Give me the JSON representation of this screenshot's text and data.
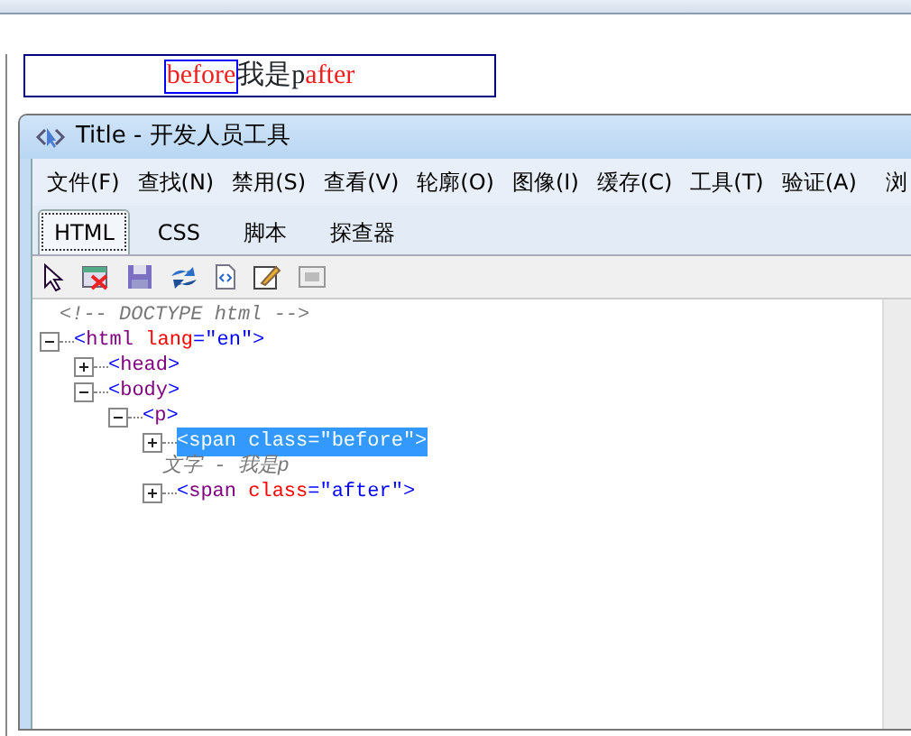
{
  "page": {
    "demo": {
      "before": "before",
      "middle": "我是p",
      "after": "after"
    }
  },
  "devtools": {
    "title": "Title - 开发人员工具",
    "menu": [
      "文件(F)",
      "查找(N)",
      "禁用(S)",
      "查看(V)",
      "轮廓(O)",
      "图像(I)",
      "缓存(C)",
      "工具(T)",
      "验证(A)",
      "浏"
    ],
    "tabs": [
      {
        "label": "HTML",
        "selected": true
      },
      {
        "label": "CSS",
        "selected": false
      },
      {
        "label": "脚本",
        "selected": false
      },
      {
        "label": "探查器",
        "selected": false
      }
    ],
    "tree": [
      {
        "kind": "comment",
        "text": "<!-- DOCTYPE html -->"
      },
      {
        "kind": "element",
        "parts": [
          {
            "kind": "bracket",
            "text": "<"
          },
          {
            "kind": "tag",
            "text": "html"
          },
          {
            "kind": "attr",
            "text": " lang"
          },
          {
            "kind": "punct",
            "text": "="
          },
          {
            "kind": "value",
            "text": "\"en\""
          },
          {
            "kind": "bracket",
            "text": ">"
          }
        ],
        "expanded": true,
        "selected": false,
        "children": [
          {
            "kind": "element",
            "parts": [
              {
                "kind": "bracket",
                "text": "<"
              },
              {
                "kind": "tag",
                "text": "head"
              },
              {
                "kind": "bracket",
                "text": ">"
              }
            ],
            "expanded": false,
            "selected": false
          },
          {
            "kind": "element",
            "parts": [
              {
                "kind": "bracket",
                "text": "<"
              },
              {
                "kind": "tag",
                "text": "body"
              },
              {
                "kind": "bracket",
                "text": ">"
              }
            ],
            "expanded": true,
            "selected": false,
            "children": [
              {
                "kind": "element",
                "parts": [
                  {
                    "kind": "bracket",
                    "text": "<"
                  },
                  {
                    "kind": "tag",
                    "text": "p"
                  },
                  {
                    "kind": "bracket",
                    "text": ">"
                  }
                ],
                "expanded": true,
                "selected": false,
                "children": [
                  {
                    "kind": "element",
                    "parts": [
                      {
                        "kind": "bracket",
                        "text": "<"
                      },
                      {
                        "kind": "tag",
                        "text": "span"
                      },
                      {
                        "kind": "attr",
                        "text": " class"
                      },
                      {
                        "kind": "punct",
                        "text": "="
                      },
                      {
                        "kind": "value",
                        "text": "\"before\""
                      },
                      {
                        "kind": "bracket",
                        "text": ">"
                      }
                    ],
                    "expanded": false,
                    "selected": true
                  },
                  {
                    "kind": "text",
                    "text": "文字 - 我是p"
                  },
                  {
                    "kind": "element",
                    "parts": [
                      {
                        "kind": "bracket",
                        "text": "<"
                      },
                      {
                        "kind": "tag",
                        "text": "span"
                      },
                      {
                        "kind": "attr",
                        "text": " class"
                      },
                      {
                        "kind": "punct",
                        "text": "="
                      },
                      {
                        "kind": "value",
                        "text": "\"after\""
                      },
                      {
                        "kind": "bracket",
                        "text": ">"
                      }
                    ],
                    "expanded": false,
                    "selected": false
                  }
                ]
              }
            ]
          }
        ]
      }
    ]
  }
}
